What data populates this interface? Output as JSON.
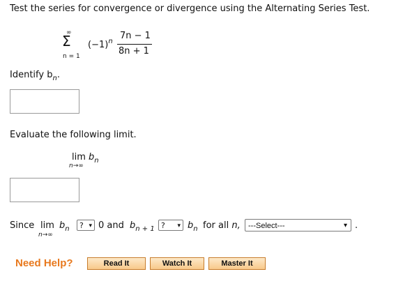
{
  "question": {
    "instruction": "Test the series for convergence or divergence using the Alternating Series Test.",
    "series": {
      "sigma": "Σ",
      "upper": "∞",
      "lower": "n = 1",
      "sign_base": "(−1)",
      "sign_exp": "n",
      "numerator": "7n − 1",
      "denominator": "8n + 1"
    },
    "identify": {
      "label": "Identify b",
      "sub": "n",
      "tail": ".",
      "value": ""
    },
    "evaluate": {
      "label": "Evaluate the following limit.",
      "lim": "lim",
      "lim_under": "n→∞",
      "b": "b",
      "b_sub": "n",
      "value": ""
    },
    "since": {
      "word": "Since",
      "lim": "lim",
      "lim_under": "n→∞",
      "b": "b",
      "b_sub": "n",
      "select1_value": "?",
      "zero_and": "0 and",
      "b2": "b",
      "b2_sub": "n + 1",
      "select2_value": "?",
      "b3": "b",
      "b3_sub": "n",
      "for_all": "for all",
      "n": "n,",
      "select3_value": "---Select---",
      "tail": "."
    }
  },
  "help": {
    "label": "Need Help?",
    "buttons": [
      "Read It",
      "Watch It",
      "Master It"
    ]
  }
}
